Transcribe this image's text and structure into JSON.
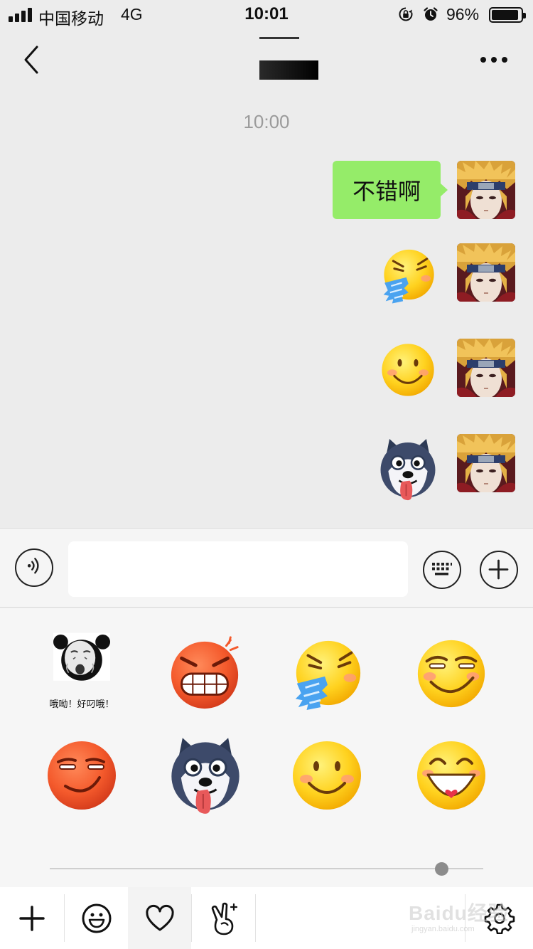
{
  "status_bar": {
    "carrier": "中国移动",
    "network": "4G",
    "time": "10:01",
    "battery_percent": "96%",
    "battery_level": 0.96,
    "icons": [
      "signal-icon",
      "orientation-lock-icon",
      "alarm-icon",
      "battery-icon"
    ]
  },
  "nav": {
    "back_icon": "chevron-left-icon",
    "more_icon": "more-dots-icon"
  },
  "chat": {
    "timestamp": "10:00",
    "messages": [
      {
        "type": "text",
        "text": "不错啊",
        "sender": "me"
      },
      {
        "type": "sticker",
        "sticker": "angry-spitting-emoji",
        "sender": "me"
      },
      {
        "type": "sticker",
        "sticker": "smile-emoji",
        "sender": "me"
      },
      {
        "type": "sticker",
        "sticker": "husky-tongue-emoji",
        "sender": "me"
      }
    ],
    "bubble_color": "#95ec69"
  },
  "input_bar": {
    "voice_icon": "voice-icon",
    "keyboard_icon": "keyboard-icon",
    "plus_icon": "plus-circle-icon",
    "input_value": ""
  },
  "emoji_panel": {
    "stickers": [
      {
        "name": "panda-meme",
        "caption": "哦呦！好叼哦！"
      },
      {
        "name": "angry-grimace-emoji"
      },
      {
        "name": "angry-spitting-emoji"
      },
      {
        "name": "smirk-emoji"
      },
      {
        "name": "red-smirk-emoji"
      },
      {
        "name": "husky-tongue-emoji"
      },
      {
        "name": "smile-emoji"
      },
      {
        "name": "laugh-heart-emoji"
      }
    ],
    "page_indicator": {
      "pages": 1,
      "current": 1
    }
  },
  "tabbar": {
    "tabs": [
      "add-icon",
      "emoji-face-icon",
      "heart-icon",
      "gesture-icon",
      "settings-gear-icon"
    ],
    "selected": "heart-icon"
  },
  "watermark": {
    "main": "Baidu经验",
    "sub": "jingyan.baidu.com"
  }
}
